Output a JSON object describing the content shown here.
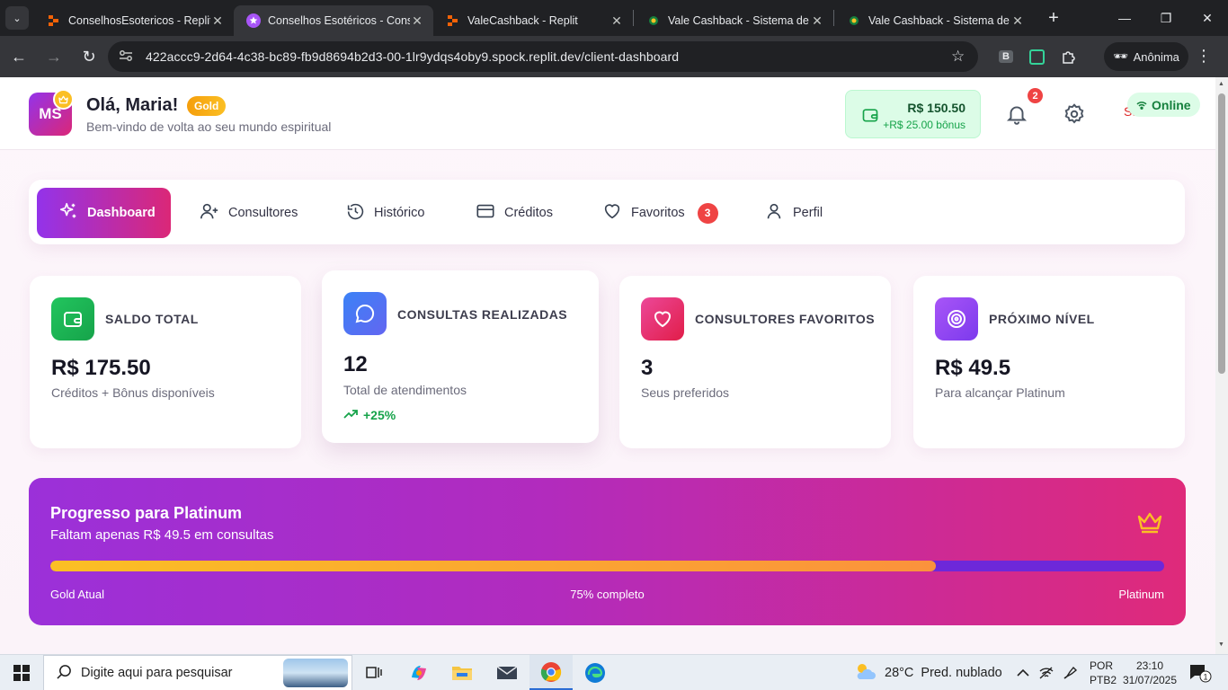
{
  "browser": {
    "tabs": [
      {
        "title": "ConselhosEsotericos - Replit",
        "icon": "replit-icon"
      },
      {
        "title": "Conselhos Esotéricos - Cons",
        "icon": "star-favicon-icon"
      },
      {
        "title": "ValeCashback - Replit",
        "icon": "replit-icon"
      },
      {
        "title": "Vale Cashback - Sistema de",
        "icon": "globe-green-icon"
      },
      {
        "title": "Vale Cashback - Sistema de",
        "icon": "globe-green-icon"
      }
    ],
    "url": "422accc9-2d64-4c38-bc89-fb9d8694b2d3-00-1lr9ydqs4oby9.spock.replit.dev/client-dashboard",
    "profile_label": "Anônima"
  },
  "header": {
    "avatar_initials": "MS",
    "greeting": "Olá, Maria!",
    "tier": "Gold",
    "subtitle": "Bem-vindo de volta ao seu mundo espiritual",
    "wallet_amount": "R$ 150.50",
    "wallet_bonus": "+R$ 25.00 bônus",
    "notif_count": "2",
    "logout_label": "Sair",
    "status": "Online"
  },
  "nav": {
    "dashboard": "Dashboard",
    "consultores": "Consultores",
    "historico": "Histórico",
    "creditos": "Créditos",
    "favoritos": "Favoritos",
    "favoritos_count": "3",
    "perfil": "Perfil"
  },
  "stats": [
    {
      "label": "SALDO TOTAL",
      "value": "R$ 175.50",
      "desc": "Créditos + Bônus disponíveis",
      "color": "#22c55e"
    },
    {
      "label": "CONSULTAS REALIZADAS",
      "value": "12",
      "desc": "Total de atendimentos",
      "trend": "+25%",
      "color": "#3b82f6"
    },
    {
      "label": "CONSULTORES FAVORITOS",
      "value": "3",
      "desc": "Seus preferidos",
      "color": "#ec4899"
    },
    {
      "label": "PRÓXIMO NÍVEL",
      "value": "R$ 49.5",
      "desc": "Para alcançar Platinum",
      "color": "#9333ea"
    }
  ],
  "progress": {
    "title": "Progresso para Platinum",
    "subtitle": "Faltam apenas R$ 49.5 em consultas",
    "percent": 0.795,
    "left_label": "Gold Atual",
    "center_label": "75% completo",
    "right_label": "Platinum"
  },
  "taskbar": {
    "search_placeholder": "Digite aqui para pesquisar",
    "weather_temp": "28°C",
    "weather_desc": "Pred. nublado",
    "lang_line1": "POR",
    "lang_line2": "PTB2",
    "time": "23:10",
    "date": "31/07/2025",
    "notif_count": "1"
  }
}
